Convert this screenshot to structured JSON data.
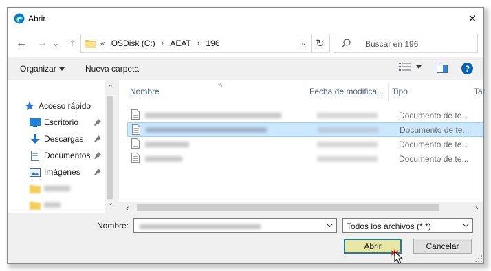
{
  "window": {
    "title": "Abrir",
    "close_glyph": "✕"
  },
  "nav": {
    "back_glyph": "←",
    "forward_glyph": "→",
    "recent_glyph": "⌄",
    "up_glyph": "↑"
  },
  "address": {
    "overflow": "«",
    "crumbs": [
      "OSDisk (C:)",
      "AEAT",
      "196"
    ],
    "separator": "›",
    "dropdown_glyph": "⌄",
    "refresh_glyph": "↻"
  },
  "search": {
    "placeholder": "Buscar en 196"
  },
  "toolbar": {
    "organize": "Organizar",
    "new_folder": "Nueva carpeta",
    "help_glyph": "?"
  },
  "sidebar": {
    "quick_access": "Acceso rápido",
    "items": [
      {
        "label": "Escritorio",
        "icon": "desktop-icon"
      },
      {
        "label": "Descargas",
        "icon": "download-icon"
      },
      {
        "label": "Documentos",
        "icon": "documents-icon"
      },
      {
        "label": "Imágenes",
        "icon": "pictures-icon"
      }
    ],
    "scroll_up": "⌃",
    "scroll_down": "⌄"
  },
  "files": {
    "columns": {
      "name": "Nombre",
      "date": "Fecha de modifica...",
      "type": "Tipo",
      "size": "Tar"
    },
    "sort_glyph": "^",
    "rows": [
      {
        "type": "Documento de te...",
        "selected": false
      },
      {
        "type": "Documento de te...",
        "selected": true
      },
      {
        "type": "Documento de te...",
        "selected": false
      },
      {
        "type": "Documento de te...",
        "selected": false
      }
    ],
    "scroll_left": "‹",
    "scroll_right": "›"
  },
  "footer": {
    "name_label": "Nombre:",
    "filter": "Todos los archivos (*.*)",
    "open": "Abrir",
    "cancel": "Cancelar"
  },
  "colors": {
    "accent": "#0078d7",
    "selection": "#cce8ff",
    "open_button": "#e8e8a4",
    "cursor_star": "#e8141e"
  }
}
